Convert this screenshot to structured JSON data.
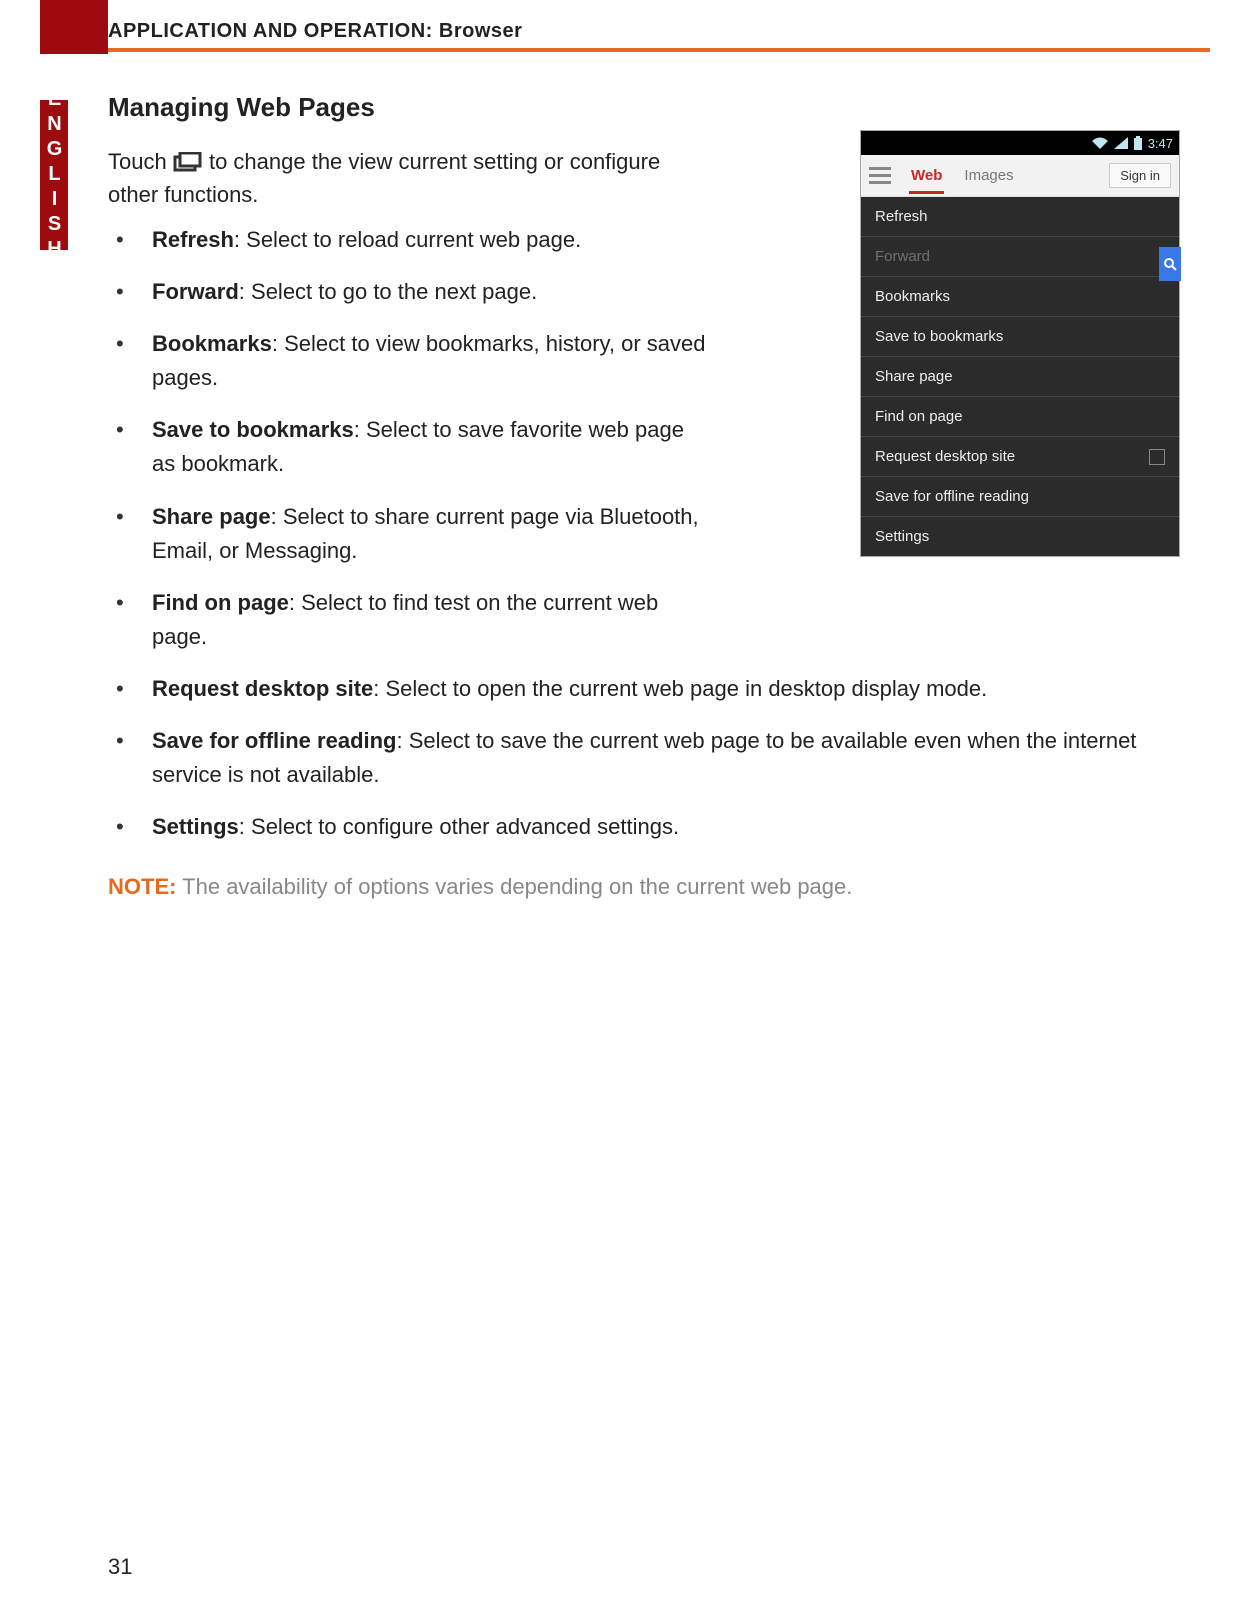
{
  "header": "APPLICATION AND OPERATION: Browser",
  "lang_tab": "ENGLISH",
  "section_title": "Managing Web Pages",
  "intro_pre": "Touch ",
  "intro_post": " to change the view current setting or configure other functions.",
  "bullets_narrow": [
    {
      "term": "Refresh",
      "desc": ": Select to reload current web page."
    },
    {
      "term": "Forward",
      "desc": ": Select to go to the next page."
    },
    {
      "term": "Bookmarks",
      "desc": ": Select to view bookmarks, history, or saved pages."
    },
    {
      "term": "Save to bookmarks",
      "desc": ": Select to save favorite web page as bookmark."
    },
    {
      "term": "Share page",
      "desc": ": Select to share current page via Bluetooth, Email, or Messaging."
    },
    {
      "term": "Find on page",
      "desc": ": Select to find test on the current web page."
    }
  ],
  "bullets_wide": [
    {
      "term": "Request desktop site",
      "desc": ": Select to open the current web page in desktop display mode."
    },
    {
      "term": "Save for offline reading",
      "desc": ": Select to save the current web page to be available even when the internet service is not available."
    },
    {
      "term": "Settings",
      "desc": ": Select to configure other advanced settings."
    }
  ],
  "note_label": "NOTE:",
  "note_text": " The availability of options varies depending on the current web page.",
  "page_number": "31",
  "screenshot": {
    "time": "3:47",
    "tab_web": "Web",
    "tab_images": "Images",
    "signin": "Sign in",
    "menu": [
      {
        "label": "Refresh",
        "disabled": false
      },
      {
        "label": "Forward",
        "disabled": true
      },
      {
        "label": "Bookmarks",
        "disabled": false
      },
      {
        "label": "Save to bookmarks",
        "disabled": false
      },
      {
        "label": "Share page",
        "disabled": false
      },
      {
        "label": "Find on page",
        "disabled": false
      },
      {
        "label": "Request desktop site",
        "disabled": false,
        "checkbox": true
      },
      {
        "label": "Save for offline reading",
        "disabled": false
      },
      {
        "label": "Settings",
        "disabled": false
      }
    ]
  }
}
